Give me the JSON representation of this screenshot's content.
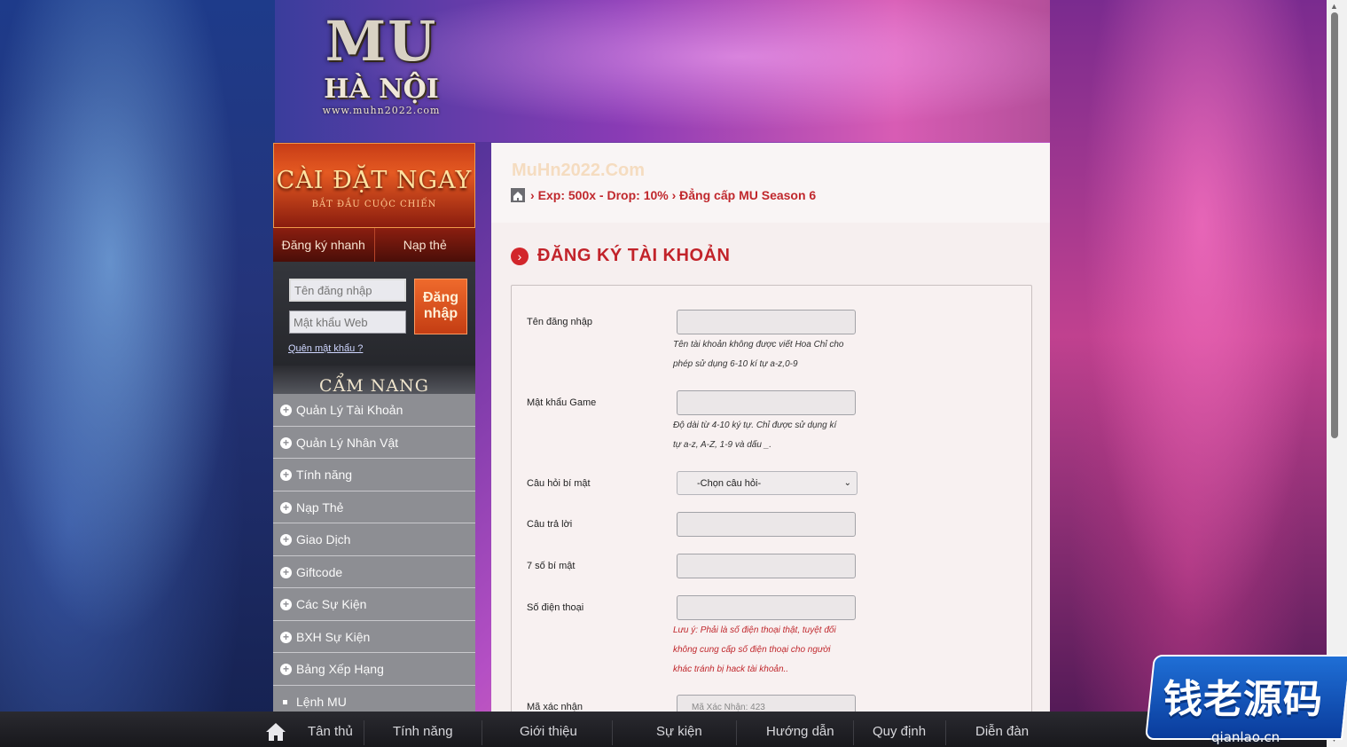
{
  "logo": {
    "line1": "MU",
    "line2": "HÀ NỘI",
    "url": "www.muhn2022.com"
  },
  "sidebar": {
    "install_title": "CÀI ĐẶT NGAY",
    "install_sub": "BẮT ĐẦU CUỘC CHIẾN",
    "quick_register": "Đăng ký nhanh",
    "top_up": "Nạp thẻ",
    "login": {
      "username_placeholder": "Tên đăng nhập",
      "password_placeholder": "Mật khẩu Web",
      "button_line1": "Đăng",
      "button_line2": "nhập",
      "forgot": "Quên mật khẩu ?"
    },
    "guide_title": "CẨM NANG",
    "menu": [
      "Quản Lý Tài Khoản",
      "Quản Lý Nhân Vật",
      "Tính năng",
      "Nạp Thẻ",
      "Giao Dịch",
      "Giftcode",
      "Các Sự Kiện",
      "BXH Sự Kiện",
      "Bảng Xếp Hạng",
      "Lệnh MU"
    ]
  },
  "main": {
    "site_name": "MuHn2022.Com",
    "breadcrumb": "Exp: 500x - Drop: 10% › Đẳng cấp MU Season 6",
    "section_title": "ĐĂNG KÝ TÀI KHOẢN",
    "form": {
      "username_label": "Tên đăng nhập",
      "username_hint_1": "Tên tài khoản không được viết Hoa Chỉ cho",
      "username_hint_2": "phép sử dụng 6-10 kí tự a-z,0-9",
      "password_label": "Mật khẩu Game",
      "password_hint_1": "Độ dài từ 4-10 ký tự. Chỉ được sử dụng kí",
      "password_hint_2": "tự a-z, A-Z, 1-9 và dấu _.",
      "question_label": "Câu hỏi bí mật",
      "question_selected": "-Chọn câu hỏi-",
      "answer_label": "Câu trả lời",
      "secret7_label": "7 số bí mật",
      "phone_label": "Số điện thoại",
      "phone_hint_1": "Lưu ý: Phải là số điện thoại thật, tuyệt đối",
      "phone_hint_2": "không cung cấp số điện thoại cho người",
      "phone_hint_3": "khác tránh bị hack tài khoản..",
      "captcha_label": "Mã xác nhận",
      "captcha_placeholder": "Mã Xác Nhận: 423"
    }
  },
  "bottom_nav": [
    "Tân thủ",
    "Tính năng",
    "Giới thiệu",
    "Sự kiện",
    "Hướng dẫn",
    "Quy định",
    "Diễn đàn"
  ],
  "watermark": {
    "text": "钱老源码",
    "url": "qianlao.cn"
  },
  "colors": {
    "accent_red": "#c2232a",
    "orange": "#e55a22",
    "menu_gray": "#8d8e93"
  }
}
